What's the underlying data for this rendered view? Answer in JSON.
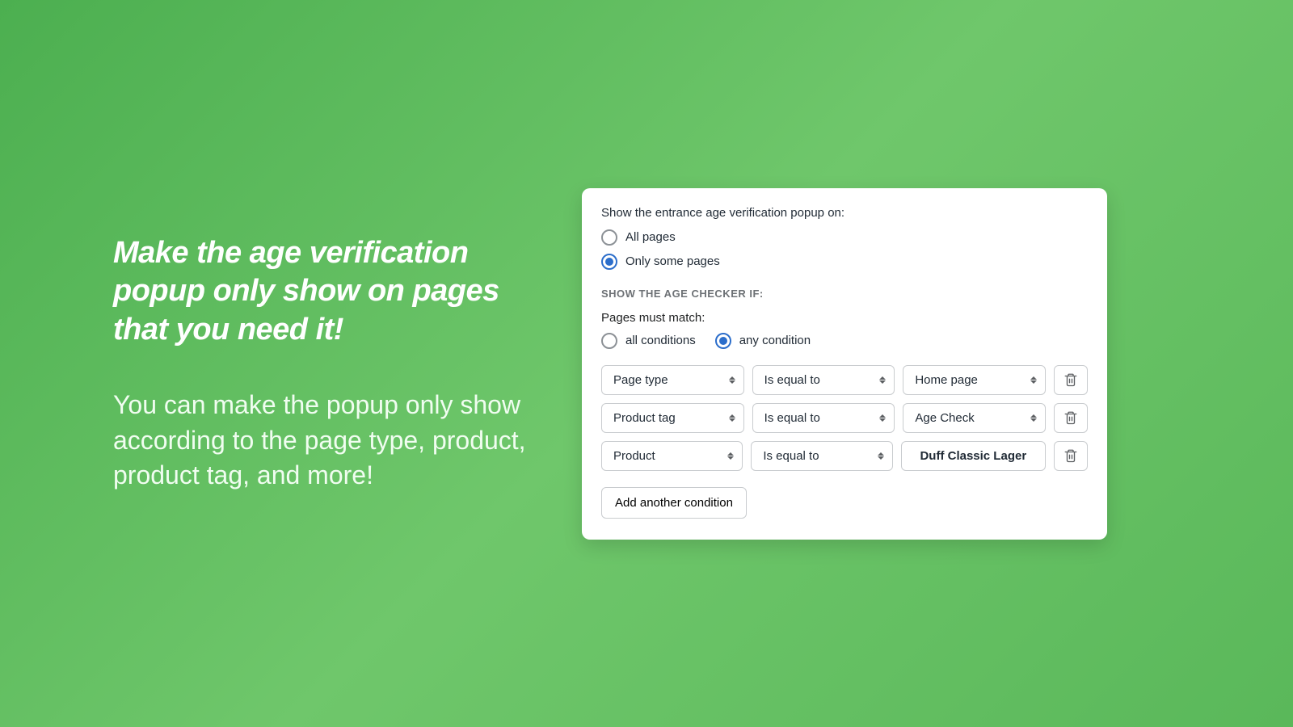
{
  "left": {
    "headline": "Make the age verification popup only show on pages that you need it!",
    "subhead": "You can make the popup only show according to the page type, product, product tag, and more!"
  },
  "panel": {
    "show_on_label": "Show the entrance age verification popup on:",
    "show_options": {
      "all": "All pages",
      "some": "Only some pages"
    },
    "section_label": "SHOW THE AGE CHECKER IF:",
    "match_label": "Pages must match:",
    "match_options": {
      "all": "all conditions",
      "any": "any condition"
    },
    "conditions": [
      {
        "field": "Page type",
        "op": "Is equal to",
        "value": "Home page",
        "value_is_select": true
      },
      {
        "field": "Product tag",
        "op": "Is equal to",
        "value": "Age Check",
        "value_is_select": true
      },
      {
        "field": "Product",
        "op": "Is equal to",
        "value": "Duff Classic Lager",
        "value_is_select": false
      }
    ],
    "add_button": "Add another condition"
  }
}
